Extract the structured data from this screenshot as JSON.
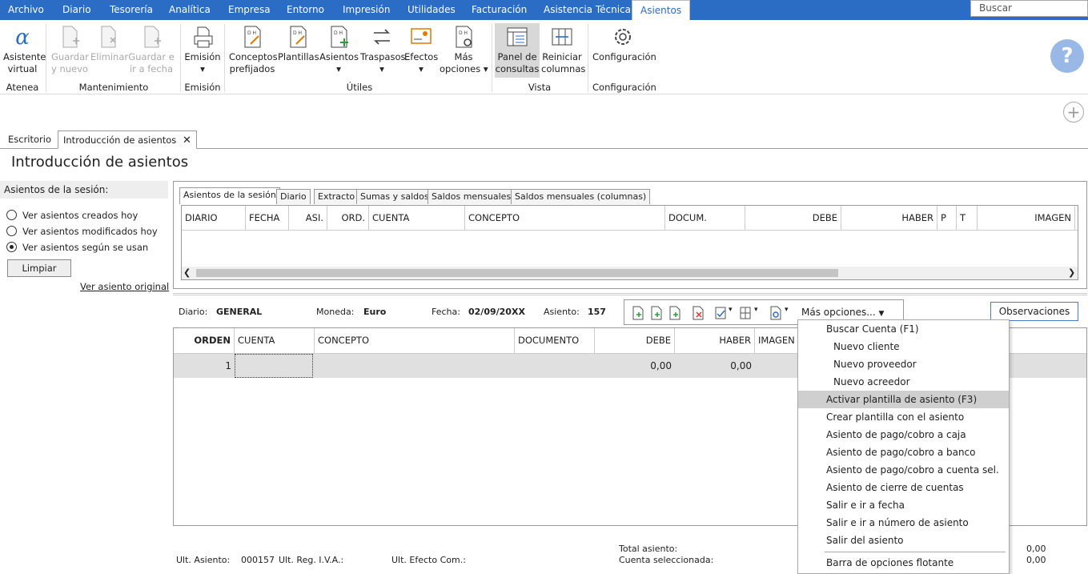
{
  "menubar": {
    "tabs": [
      "Archivo",
      "Diario",
      "Tesorería",
      "Analítica",
      "Empresa",
      "Entorno",
      "Impresión",
      "Utilidades",
      "Facturación",
      "Asistencia Técnica",
      "Asientos"
    ],
    "search_placeholder": "Buscar"
  },
  "ribbon": {
    "asistente": [
      "Asistente",
      "virtual"
    ],
    "guardar_nuevo": [
      "Guardar",
      "y nuevo"
    ],
    "eliminar": "Eliminar",
    "guardar_fecha": [
      "Guardar e",
      "ir a fecha"
    ],
    "emision_btn": "Emisión",
    "conceptos": [
      "Conceptos",
      "prefijados"
    ],
    "plantillas": "Plantillas",
    "asientos": "Asientos",
    "traspasos": "Traspasos",
    "efectos": "Efectos",
    "mas_opciones": [
      "Más",
      "opciones"
    ],
    "panel": [
      "Panel de",
      "consultas"
    ],
    "reiniciar": [
      "Reiniciar",
      "columnas"
    ],
    "configuracion_btn": "Configuración",
    "groups": {
      "atenea": "Atenea",
      "mantenimiento": "Mantenimiento",
      "emision": "Emisión",
      "utiles": "Útiles",
      "vista": "Vista",
      "configuracion": "Configuración"
    }
  },
  "doc_tabs": {
    "escritorio": "Escritorio",
    "introduccion": "Introducción de asientos"
  },
  "page_title": "Introducción de asientos",
  "session": {
    "title": "Asientos de la sesión:",
    "options": [
      "Ver asientos creados hoy",
      "Ver asientos modificados hoy",
      "Ver asientos según se usan"
    ],
    "selected_index": 2,
    "clear_button": "Limpiar",
    "original_link": "Ver asiento original"
  },
  "upper_tabs": [
    "Asientos de la sesión",
    "Diario",
    "Extracto",
    "Sumas y saldos",
    "Saldos mensuales",
    "Saldos mensuales (columnas)"
  ],
  "upper_columns": [
    "DIARIO",
    "FECHA",
    "ASI.",
    "ORD.",
    "CUENTA",
    "CONCEPTO",
    "DOCUM.",
    "DEBE",
    "HABER",
    "P",
    "T",
    "IMAGEN"
  ],
  "entry_bar": {
    "diario_label": "Diario:",
    "diario_value": "GENERAL",
    "moneda_label": "Moneda:",
    "moneda_value": "Euro",
    "fecha_label": "Fecha:",
    "fecha_value": "02/09/20XX",
    "asiento_label": "Asiento:",
    "asiento_value": "157",
    "mas_opciones": "Más opciones...",
    "observaciones": "Observaciones"
  },
  "lower_columns": [
    "ORDEN",
    "CUENTA",
    "CONCEPTO",
    "DOCUMENTO",
    "DEBE",
    "HABER",
    "IMAGEN"
  ],
  "lower_row": {
    "orden": "1",
    "debe": "0,00",
    "haber": "0,00"
  },
  "footer": {
    "ult_asiento_label": "Ult. Asiento:",
    "ult_asiento_value": "000157",
    "ult_reg_iva_label": "Ult. Reg. I.V.A.:",
    "ult_efecto_label": "Ult. Efecto Com.:",
    "total_label": "Total asiento:",
    "cuenta_label": "Cuenta seleccionada:",
    "total_value": "0,00",
    "cuenta_value": "0,00"
  },
  "dropdown": {
    "items": [
      "Buscar Cuenta (F1)",
      "Nuevo cliente",
      "Nuevo proveedor",
      "Nuevo acreedor",
      "Activar plantilla de asiento (F3)",
      "Crear plantilla con el asiento",
      "Asiento de pago/cobro a caja",
      "Asiento de pago/cobro a banco",
      "Asiento de pago/cobro a cuenta sel.",
      "Asiento de cierre de cuentas",
      "Salir e ir a fecha",
      "Salir e ir a número de asiento",
      "Salir del asiento"
    ],
    "highlighted_index": 4,
    "floating": "Barra de opciones flotante"
  },
  "colors": {
    "menubar": "#2b6cc4",
    "highlight": "#cfcfcf",
    "help": "#9ab8e6"
  }
}
